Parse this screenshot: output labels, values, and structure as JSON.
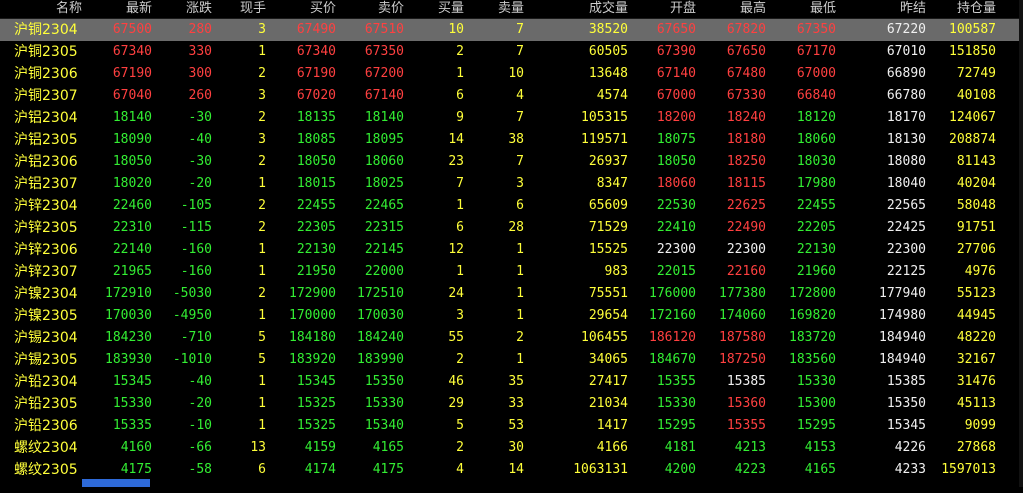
{
  "headers": [
    "名称",
    "最新",
    "涨跌",
    "现手",
    "买价",
    "卖价",
    "买量",
    "卖量",
    "成交量",
    "开盘",
    "最高",
    "最低",
    "昨结",
    "持仓量"
  ],
  "colors": {
    "up": "#ff4040",
    "down": "#33ee33",
    "flat": "#f0f0f0",
    "volume": "#ffff3a",
    "name": "#ffff3a",
    "selected_bg": "#6a6a6a"
  },
  "rows": [
    {
      "name": "沪铜2304",
      "last": "67500",
      "chg": "280",
      "hand": "3",
      "bid": "67490",
      "ask": "67510",
      "bidv": "10",
      "askv": "7",
      "vol": "38520",
      "open": "67650",
      "high": "67820",
      "low": "67350",
      "prev": "67220",
      "oi": "100587",
      "dir": "up",
      "open_d": "up",
      "high_d": "up",
      "low_d": "up",
      "selected": true
    },
    {
      "name": "沪铜2305",
      "last": "67340",
      "chg": "330",
      "hand": "1",
      "bid": "67340",
      "ask": "67350",
      "bidv": "2",
      "askv": "7",
      "vol": "60505",
      "open": "67390",
      "high": "67650",
      "low": "67170",
      "prev": "67010",
      "oi": "151850",
      "dir": "up",
      "open_d": "up",
      "high_d": "up",
      "low_d": "up"
    },
    {
      "name": "沪铜2306",
      "last": "67190",
      "chg": "300",
      "hand": "2",
      "bid": "67190",
      "ask": "67200",
      "bidv": "1",
      "askv": "10",
      "vol": "13648",
      "open": "67140",
      "high": "67480",
      "low": "67000",
      "prev": "66890",
      "oi": "72749",
      "dir": "up",
      "open_d": "up",
      "high_d": "up",
      "low_d": "up"
    },
    {
      "name": "沪铜2307",
      "last": "67040",
      "chg": "260",
      "hand": "3",
      "bid": "67020",
      "ask": "67140",
      "bidv": "6",
      "askv": "4",
      "vol": "4574",
      "open": "67000",
      "high": "67330",
      "low": "66840",
      "prev": "66780",
      "oi": "40108",
      "dir": "up",
      "open_d": "up",
      "high_d": "up",
      "low_d": "up"
    },
    {
      "name": "沪铝2304",
      "last": "18140",
      "chg": "-30",
      "hand": "2",
      "bid": "18135",
      "ask": "18140",
      "bidv": "9",
      "askv": "7",
      "vol": "105315",
      "open": "18200",
      "high": "18240",
      "low": "18120",
      "prev": "18170",
      "oi": "124067",
      "dir": "down",
      "open_d": "up",
      "high_d": "up",
      "low_d": "down"
    },
    {
      "name": "沪铝2305",
      "last": "18090",
      "chg": "-40",
      "hand": "3",
      "bid": "18085",
      "ask": "18095",
      "bidv": "14",
      "askv": "38",
      "vol": "119571",
      "open": "18075",
      "high": "18180",
      "low": "18060",
      "prev": "18130",
      "oi": "208874",
      "dir": "down",
      "open_d": "down",
      "high_d": "up",
      "low_d": "down"
    },
    {
      "name": "沪铝2306",
      "last": "18050",
      "chg": "-30",
      "hand": "2",
      "bid": "18050",
      "ask": "18060",
      "bidv": "23",
      "askv": "7",
      "vol": "26937",
      "open": "18050",
      "high": "18250",
      "low": "18030",
      "prev": "18080",
      "oi": "81143",
      "dir": "down",
      "open_d": "down",
      "high_d": "up",
      "low_d": "down"
    },
    {
      "name": "沪铝2307",
      "last": "18020",
      "chg": "-20",
      "hand": "1",
      "bid": "18015",
      "ask": "18025",
      "bidv": "7",
      "askv": "3",
      "vol": "8347",
      "open": "18060",
      "high": "18115",
      "low": "17980",
      "prev": "18040",
      "oi": "40204",
      "dir": "down",
      "open_d": "up",
      "high_d": "up",
      "low_d": "down"
    },
    {
      "name": "沪锌2304",
      "last": "22460",
      "chg": "-105",
      "hand": "2",
      "bid": "22455",
      "ask": "22465",
      "bidv": "1",
      "askv": "6",
      "vol": "65609",
      "open": "22530",
      "high": "22625",
      "low": "22455",
      "prev": "22565",
      "oi": "58048",
      "dir": "down",
      "open_d": "down",
      "high_d": "up",
      "low_d": "down"
    },
    {
      "name": "沪锌2305",
      "last": "22310",
      "chg": "-115",
      "hand": "2",
      "bid": "22305",
      "ask": "22315",
      "bidv": "6",
      "askv": "28",
      "vol": "71529",
      "open": "22410",
      "high": "22490",
      "low": "22205",
      "prev": "22425",
      "oi": "91751",
      "dir": "down",
      "open_d": "down",
      "high_d": "up",
      "low_d": "down"
    },
    {
      "name": "沪锌2306",
      "last": "22140",
      "chg": "-160",
      "hand": "1",
      "bid": "22130",
      "ask": "22145",
      "bidv": "12",
      "askv": "1",
      "vol": "15525",
      "open": "22300",
      "high": "22300",
      "low": "22130",
      "prev": "22300",
      "oi": "27706",
      "dir": "down",
      "open_d": "flat",
      "high_d": "flat",
      "low_d": "down"
    },
    {
      "name": "沪锌2307",
      "last": "21965",
      "chg": "-160",
      "hand": "1",
      "bid": "21950",
      "ask": "22000",
      "bidv": "1",
      "askv": "1",
      "vol": "983",
      "open": "22015",
      "high": "22160",
      "low": "21960",
      "prev": "22125",
      "oi": "4976",
      "dir": "down",
      "open_d": "down",
      "high_d": "up",
      "low_d": "down"
    },
    {
      "name": "沪镍2304",
      "last": "172910",
      "chg": "-5030",
      "hand": "2",
      "bid": "172900",
      "ask": "172510",
      "bidv": "24",
      "askv": "1",
      "vol": "75551",
      "open": "176000",
      "high": "177380",
      "low": "172800",
      "prev": "177940",
      "oi": "55123",
      "dir": "down",
      "open_d": "down",
      "high_d": "down",
      "low_d": "down"
    },
    {
      "name": "沪镍2305",
      "last": "170030",
      "chg": "-4950",
      "hand": "1",
      "bid": "170000",
      "ask": "170030",
      "bidv": "3",
      "askv": "1",
      "vol": "29654",
      "open": "172160",
      "high": "174060",
      "low": "169820",
      "prev": "174980",
      "oi": "44945",
      "dir": "down",
      "open_d": "down",
      "high_d": "down",
      "low_d": "down"
    },
    {
      "name": "沪锡2304",
      "last": "184230",
      "chg": "-710",
      "hand": "5",
      "bid": "184180",
      "ask": "184240",
      "bidv": "55",
      "askv": "2",
      "vol": "106455",
      "open": "186120",
      "high": "187580",
      "low": "183720",
      "prev": "184940",
      "oi": "48220",
      "dir": "down",
      "open_d": "up",
      "high_d": "up",
      "low_d": "down"
    },
    {
      "name": "沪锡2305",
      "last": "183930",
      "chg": "-1010",
      "hand": "5",
      "bid": "183920",
      "ask": "183990",
      "bidv": "2",
      "askv": "1",
      "vol": "34065",
      "open": "184670",
      "high": "187250",
      "low": "183560",
      "prev": "184940",
      "oi": "32167",
      "dir": "down",
      "open_d": "down",
      "high_d": "up",
      "low_d": "down"
    },
    {
      "name": "沪铅2304",
      "last": "15345",
      "chg": "-40",
      "hand": "1",
      "bid": "15345",
      "ask": "15350",
      "bidv": "46",
      "askv": "35",
      "vol": "27417",
      "open": "15355",
      "high": "15385",
      "low": "15330",
      "prev": "15385",
      "oi": "31476",
      "dir": "down",
      "open_d": "down",
      "high_d": "flat",
      "low_d": "down"
    },
    {
      "name": "沪铅2305",
      "last": "15330",
      "chg": "-20",
      "hand": "1",
      "bid": "15325",
      "ask": "15330",
      "bidv": "29",
      "askv": "33",
      "vol": "21034",
      "open": "15330",
      "high": "15360",
      "low": "15300",
      "prev": "15350",
      "oi": "45113",
      "dir": "down",
      "open_d": "down",
      "high_d": "up",
      "low_d": "down"
    },
    {
      "name": "沪铅2306",
      "last": "15335",
      "chg": "-10",
      "hand": "1",
      "bid": "15325",
      "ask": "15340",
      "bidv": "5",
      "askv": "53",
      "vol": "1417",
      "open": "15295",
      "high": "15355",
      "low": "15295",
      "prev": "15345",
      "oi": "9099",
      "dir": "down",
      "open_d": "down",
      "high_d": "up",
      "low_d": "down"
    },
    {
      "name": "螺纹2304",
      "last": "4160",
      "chg": "-66",
      "hand": "13",
      "bid": "4159",
      "ask": "4165",
      "bidv": "2",
      "askv": "30",
      "vol": "4166",
      "open": "4181",
      "high": "4213",
      "low": "4153",
      "prev": "4226",
      "oi": "27868",
      "dir": "down",
      "open_d": "down",
      "high_d": "down",
      "low_d": "down"
    },
    {
      "name": "螺纹2305",
      "last": "4175",
      "chg": "-58",
      "hand": "6",
      "bid": "4174",
      "ask": "4175",
      "bidv": "4",
      "askv": "14",
      "vol": "1063131",
      "open": "4200",
      "high": "4223",
      "low": "4165",
      "prev": "4233",
      "oi": "1597013",
      "dir": "down",
      "open_d": "down",
      "high_d": "down",
      "low_d": "down"
    }
  ]
}
